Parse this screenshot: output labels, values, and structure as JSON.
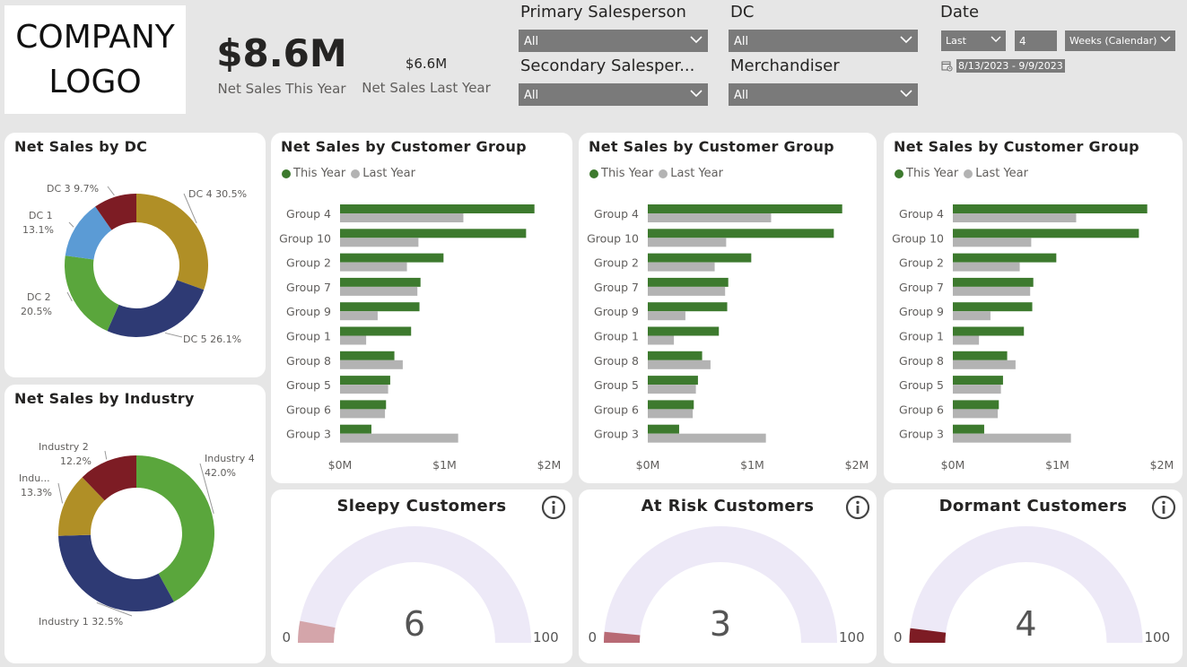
{
  "logo": {
    "line1": "COMPANY",
    "line2": "LOGO"
  },
  "kpis": {
    "this_year": {
      "value": "$8.6M",
      "label": "Net Sales This Year"
    },
    "last_year": {
      "value": "$6.6M",
      "label": "Net Sales Last Year"
    }
  },
  "filters": {
    "primary_salesperson": {
      "title": "Primary Salesperson",
      "value": "All"
    },
    "secondary_salesperson": {
      "title": "Secondary Salesper...",
      "value": "All"
    },
    "dc": {
      "title": "DC",
      "value": "All"
    },
    "merchandiser": {
      "title": "Merchandiser",
      "value": "All"
    },
    "date": {
      "title": "Date",
      "mode": "Last",
      "count": "4",
      "unit": "Weeks (Calendar)",
      "range": "8/13/2023 - 9/9/2023",
      "icon": "calendar-icon"
    }
  },
  "colors": {
    "this_year": "#3d7a2e",
    "last_year": "#b3b3b3",
    "gauge_track": "#ede9f7"
  },
  "donut_dc": {
    "title": "Net Sales by DC",
    "chart_data": {
      "type": "pie",
      "slices": [
        {
          "name": "DC 4",
          "value": 30.5,
          "label": "DC 4 30.5%",
          "color": "#b08f26"
        },
        {
          "name": "DC 5",
          "value": 26.1,
          "label": "DC 5 26.1%",
          "color": "#2e3a74"
        },
        {
          "name": "DC 2",
          "value": 20.5,
          "label_l1": "DC 2",
          "label_l2": "20.5%",
          "color": "#5aa63c"
        },
        {
          "name": "DC 1",
          "value": 13.1,
          "label_l1": "DC 1",
          "label_l2": "13.1%",
          "color": "#5b9bd5"
        },
        {
          "name": "DC 3",
          "value": 9.7,
          "label": "DC 3 9.7%",
          "color": "#7d1c24"
        }
      ]
    }
  },
  "donut_industry": {
    "title": "Net Sales by Industry",
    "chart_data": {
      "type": "pie",
      "slices": [
        {
          "name": "Industry 4",
          "value": 42.0,
          "label_l1": "Industry 4",
          "label_l2": "42.0%",
          "color": "#5aa63c"
        },
        {
          "name": "Industry 1",
          "value": 32.5,
          "label": "Industry 1 32.5%",
          "color": "#2e3a74"
        },
        {
          "name": "Indu...",
          "value": 13.3,
          "label_l1": "Indu...",
          "label_l2": "13.3%",
          "color": "#b08f26"
        },
        {
          "name": "Industry 2",
          "value": 12.2,
          "label_l1": "Industry 2",
          "label_l2": "12.2%",
          "color": "#7d1c24"
        }
      ]
    }
  },
  "bar_legend": {
    "this_year": "This Year",
    "last_year": "Last Year"
  },
  "bar_charts": [
    {
      "title": "Net Sales by Customer Group",
      "chart_data": {
        "type": "bar",
        "orientation": "horizontal",
        "categories": [
          "Group 4",
          "Group 10",
          "Group 2",
          "Group 7",
          "Group 9",
          "Group 1",
          "Group 8",
          "Group 5",
          "Group 6",
          "Group 3"
        ],
        "series": [
          {
            "name": "This Year",
            "values": [
              1.86,
              1.78,
              0.99,
              0.77,
              0.76,
              0.68,
              0.52,
              0.48,
              0.44,
              0.3
            ]
          },
          {
            "name": "Last Year",
            "values": [
              1.18,
              0.75,
              0.64,
              0.74,
              0.36,
              0.25,
              0.6,
              0.46,
              0.43,
              1.13
            ]
          }
        ],
        "xticks": [
          "$0M",
          "$1M",
          "$2M"
        ],
        "xlim": [
          0,
          2
        ]
      }
    },
    {
      "title": "Net Sales by Customer Group",
      "chart_data": {
        "type": "bar",
        "orientation": "horizontal",
        "categories": [
          "Group 4",
          "Group 10",
          "Group 2",
          "Group 7",
          "Group 9",
          "Group 1",
          "Group 8",
          "Group 5",
          "Group 6",
          "Group 3"
        ],
        "series": [
          {
            "name": "This Year",
            "values": [
              1.86,
              1.78,
              0.99,
              0.77,
              0.76,
              0.68,
              0.52,
              0.48,
              0.44,
              0.3
            ]
          },
          {
            "name": "Last Year",
            "values": [
              1.18,
              0.75,
              0.64,
              0.74,
              0.36,
              0.25,
              0.6,
              0.46,
              0.43,
              1.13
            ]
          }
        ],
        "xticks": [
          "$0M",
          "$1M",
          "$2M"
        ],
        "xlim": [
          0,
          2
        ]
      }
    },
    {
      "title": "Net Sales by Customer Group",
      "chart_data": {
        "type": "bar",
        "orientation": "horizontal",
        "categories": [
          "Group 4",
          "Group 10",
          "Group 2",
          "Group 7",
          "Group 9",
          "Group 1",
          "Group 8",
          "Group 5",
          "Group 6",
          "Group 3"
        ],
        "series": [
          {
            "name": "This Year",
            "values": [
              1.86,
              1.78,
              0.99,
              0.77,
              0.76,
              0.68,
              0.52,
              0.48,
              0.44,
              0.3
            ]
          },
          {
            "name": "Last Year",
            "values": [
              1.18,
              0.75,
              0.64,
              0.74,
              0.36,
              0.25,
              0.6,
              0.46,
              0.43,
              1.13
            ]
          }
        ],
        "xticks": [
          "$0M",
          "$1M",
          "$2M"
        ],
        "xlim": [
          0,
          2
        ]
      }
    }
  ],
  "gauges": [
    {
      "title": "Sleepy Customers",
      "value": "6",
      "min": "0",
      "max": "100",
      "level": 6,
      "fill": "#d4a5aa"
    },
    {
      "title": "At Risk Customers",
      "value": "3",
      "min": "0",
      "max": "100",
      "level": 3,
      "fill": "#b86a75"
    },
    {
      "title": "Dormant Customers",
      "value": "4",
      "min": "0",
      "max": "100",
      "level": 4,
      "fill": "#7d1c24"
    }
  ]
}
